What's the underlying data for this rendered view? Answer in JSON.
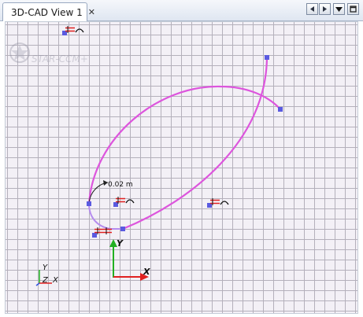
{
  "window": {
    "tab_title": "3D-CAD View 1",
    "tab_close_icon": "close-icon"
  },
  "view_controls": [
    {
      "name": "scroll-left-button",
      "icon": "arrow-left-icon"
    },
    {
      "name": "scroll-right-button",
      "icon": "arrow-right-icon"
    },
    {
      "name": "view-menu-button",
      "icon": "triangle-down-icon"
    },
    {
      "name": "maximize-button",
      "icon": "maximize-icon"
    }
  ],
  "watermark": {
    "text": "STAR-CCM+"
  },
  "sketch": {
    "dimension_label": "0.02 m",
    "curve_color": "#dd55dd",
    "handle_color": "#5a5ae0",
    "constraint_color": "#e02020"
  },
  "axes": {
    "main": {
      "x_label": "X",
      "y_label": "Y",
      "x_color": "#e02020",
      "y_color": "#22b022"
    },
    "triad": {
      "x_label": "X",
      "y_label": "Y",
      "z_label": "Z"
    }
  }
}
